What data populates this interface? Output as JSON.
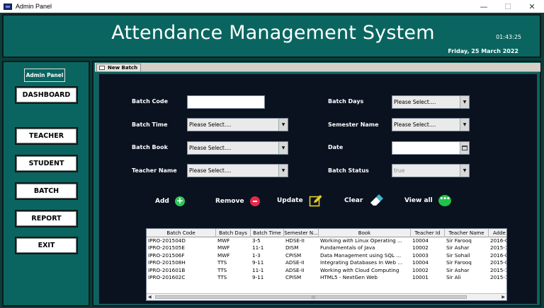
{
  "window": {
    "title": "Admin Panel",
    "controls": {
      "minimize": "—",
      "maximize": "☐",
      "close": "✕"
    }
  },
  "header": {
    "title": "Attendance Management System",
    "time": "01:43:25",
    "date": "Friday, 25 March 2022"
  },
  "sidebar": {
    "label": "Admin Panel",
    "items": [
      {
        "label": "DASHBOARD"
      },
      {
        "label": "TEACHER"
      },
      {
        "label": "STUDENT"
      },
      {
        "label": "BATCH"
      },
      {
        "label": "REPORT"
      },
      {
        "label": "EXIT"
      }
    ]
  },
  "frame": {
    "tab_label": "New Batch"
  },
  "form": {
    "batch_code": {
      "label": "Batch Code",
      "value": ""
    },
    "batch_time": {
      "label": "Batch Time",
      "value": "Please Select...."
    },
    "batch_book": {
      "label": "Batch Book",
      "value": "Please Select...."
    },
    "teacher_name": {
      "label": "Teacher Name",
      "value": "Please Select...."
    },
    "batch_days": {
      "label": "Batch Days",
      "value": "Please Select...."
    },
    "semester_name": {
      "label": "Semester Name",
      "value": "Please Select...."
    },
    "date": {
      "label": "Date",
      "value": ""
    },
    "batch_status": {
      "label": "Batch Status",
      "value": "true"
    }
  },
  "actions": {
    "add": "Add",
    "remove": "Remove",
    "update": "Update",
    "clear": "Clear",
    "view_all": "View all"
  },
  "colors": {
    "window_bg": "#0b3d3a",
    "header_bg": "#0a6560",
    "panel_bg": "#0a1220",
    "add_icon": "#2ec85a",
    "remove_icon": "#e8294a",
    "update_icon": "#e8d020",
    "view_icon": "#22c24a"
  },
  "table": {
    "columns": [
      "Batch Code",
      "Batch Days",
      "Batch Time",
      "Semester N...",
      "Book",
      "Teacher Id",
      "Teacher Name",
      "Adde"
    ],
    "rows": [
      [
        "IPRO-201504D",
        "MWF",
        "3-5",
        "HDSE-II",
        "Working with Linux Operating ...",
        "10004",
        "Sir Farooq",
        "2016-0"
      ],
      [
        "IPRO-201505E",
        "MWF",
        "11-1",
        "DISM",
        "Fundamentals of Java",
        "10002",
        "Sir Ashar",
        "2015-1"
      ],
      [
        "IPRO-201506F",
        "MWF",
        "1-3",
        "CPISM",
        "Data Management using SQL ...",
        "10003",
        "Sir Sohail",
        "2016-0"
      ],
      [
        "IPRO-201508H",
        "TTS",
        "9-11",
        "ADSE-II",
        "Integrating Databases In Web ...",
        "10004",
        "Sir Farooq",
        "2015-0"
      ],
      [
        "IPRO-201601B",
        "TTS",
        "11-1",
        "ADSE-II",
        "Working with Cloud Computing",
        "10002",
        "Sir Ashar",
        "2015-1"
      ],
      [
        "IPRO-201602C",
        "TTS",
        "9-11",
        "CPISM",
        "HTML5 - NextGen Web",
        "10001",
        "Sir Ali",
        "2015-1"
      ]
    ],
    "scroll": {
      "left": "◀",
      "right": "▶",
      "grip": "|||"
    }
  }
}
